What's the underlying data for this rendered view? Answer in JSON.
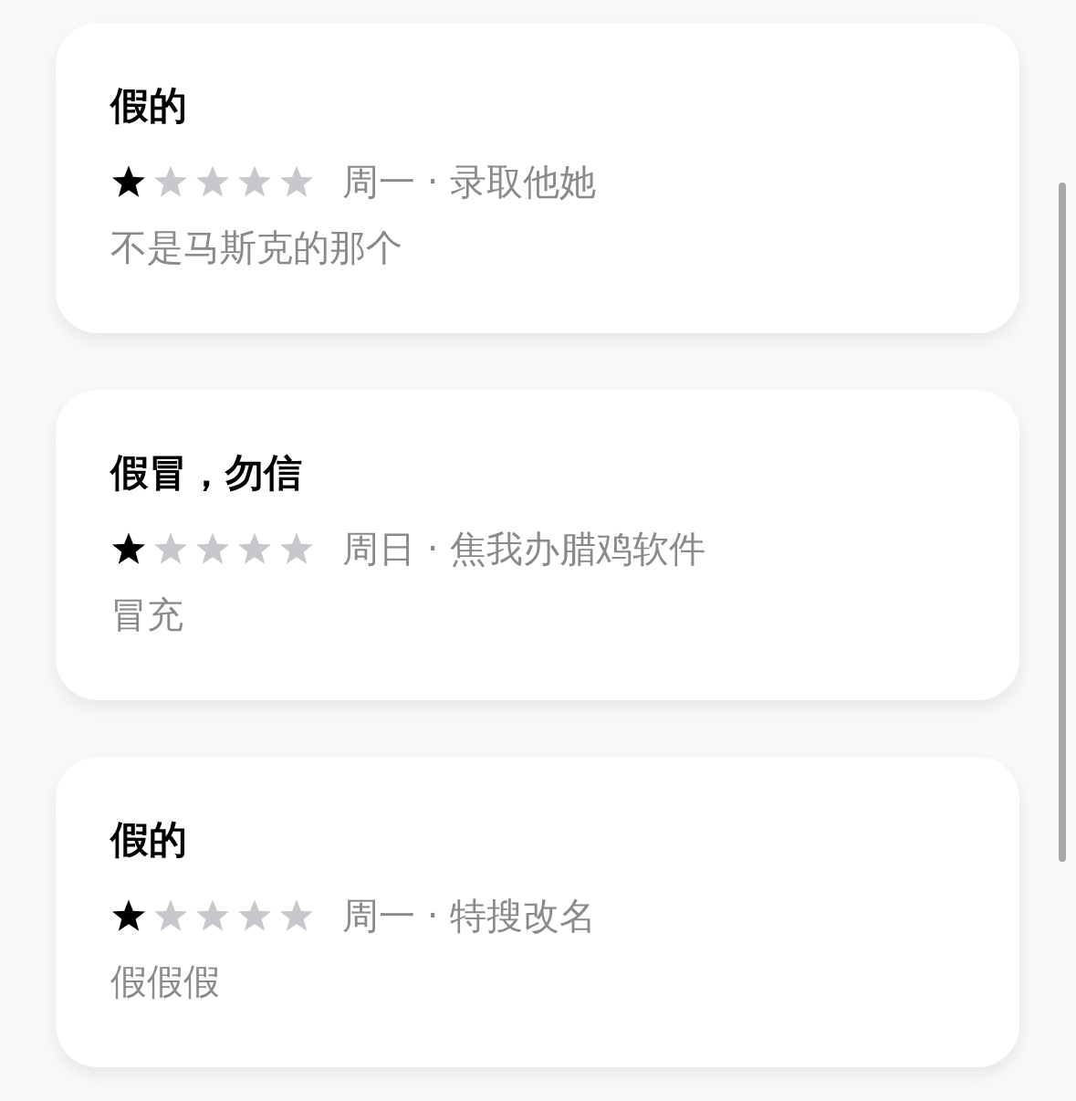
{
  "reviews": [
    {
      "title": "假的",
      "stars": 1,
      "meta": "周一 · 录取他她",
      "body": "不是马斯克的那个"
    },
    {
      "title": "假冒，勿信",
      "stars": 1,
      "meta": "周日 · 焦我办腊鸡软件",
      "body": "冒充"
    },
    {
      "title": "假的",
      "stars": 1,
      "meta": "周一 · 特搜改名",
      "body": "假假假"
    }
  ]
}
